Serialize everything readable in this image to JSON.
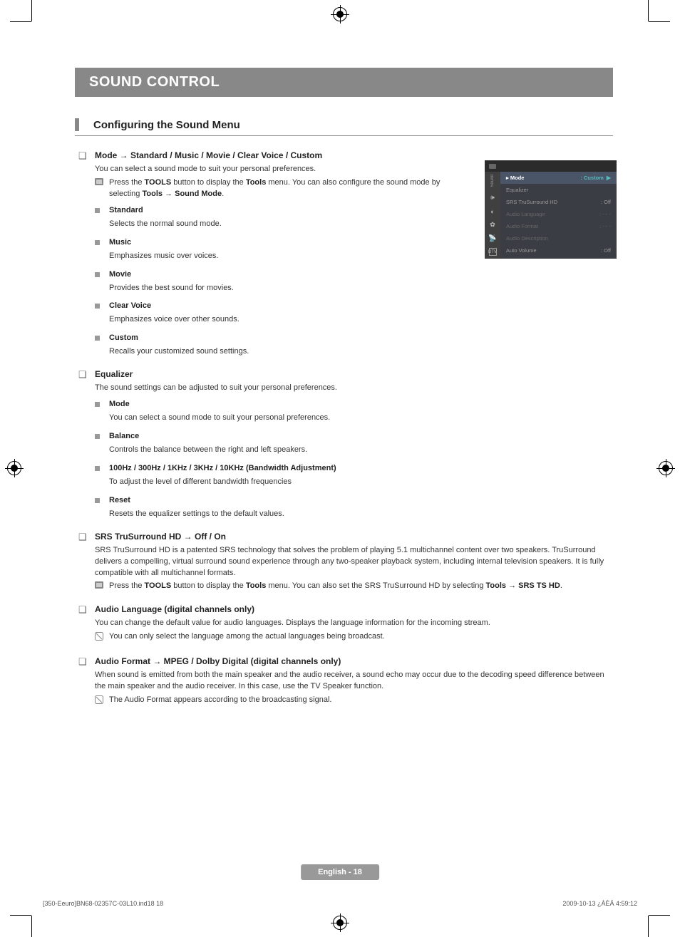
{
  "header": {
    "title": "SOUND CONTROL"
  },
  "section": {
    "title": "Configuring the Sound Menu"
  },
  "mode": {
    "heading": "Mode → Standard / Music / Movie / Clear Voice / Custom",
    "intro": "You can select a sound mode to suit your personal preferences.",
    "tools_note_a": "Press the ",
    "tools_note_b": " button to display the ",
    "tools_note_c": " menu. You can also configure the sound mode by selecting ",
    "tools_note_d": ".",
    "tools_label": "TOOLS",
    "tools_menu": "Tools",
    "tools_path": "Tools → Sound Mode",
    "items": [
      {
        "name": "Standard",
        "desc": "Selects the normal sound mode."
      },
      {
        "name": "Music",
        "desc": "Emphasizes music over voices."
      },
      {
        "name": "Movie",
        "desc": "Provides the best sound for movies."
      },
      {
        "name": "Clear Voice",
        "desc": "Emphasizes voice over other sounds."
      },
      {
        "name": "Custom",
        "desc": "Recalls your customized sound settings."
      }
    ]
  },
  "equalizer": {
    "heading": "Equalizer",
    "intro": "The sound settings can be adjusted to suit your personal preferences.",
    "items": [
      {
        "name": "Mode",
        "desc": "You can select a sound mode to suit your personal preferences."
      },
      {
        "name": "Balance",
        "desc": "Controls the balance between the right and left speakers."
      },
      {
        "name": "100Hz / 300Hz / 1KHz / 3KHz / 10KHz (Bandwidth Adjustment)",
        "desc": "To adjust the level of different bandwidth frequencies"
      },
      {
        "name": "Reset",
        "desc": "Resets the equalizer settings to the default values."
      }
    ]
  },
  "srs": {
    "heading": "SRS TruSurround HD → Off / On",
    "desc": "SRS TruSurround HD is a patented SRS technology that solves the problem of playing 5.1 multichannel content over two speakers. TruSurround delivers a compelling, virtual surround sound experience through any two-speaker playback system, including internal television speakers. It is fully compatible with all multichannel formats.",
    "tools_note_a": "Press the ",
    "tools_note_b": " button to display the ",
    "tools_note_c": " menu. You can also set the SRS TruSurround HD by selecting ",
    "tools_note_d": ".",
    "tools_label": "TOOLS",
    "tools_menu": "Tools",
    "tools_path": "Tools → SRS TS HD"
  },
  "audio_lang": {
    "heading": "Audio Language (digital channels only)",
    "desc": "You can change the default value for audio languages. Displays the language information for the incoming stream.",
    "note": "You can only select the language among the actual languages being broadcast."
  },
  "audio_format": {
    "heading": "Audio Format → MPEG / Dolby Digital (digital channels only)",
    "desc": "When sound is emitted from both the main speaker and the audio receiver, a sound echo may occur due to the decoding speed difference between the main speaker and the audio receiver. In this case, use the TV Speaker function.",
    "note": "The Audio Format appears according to the broadcasting signal."
  },
  "osd": {
    "sidebar_label": "Sound",
    "rows": [
      {
        "label": "Mode",
        "value": ": Custom",
        "highlight": true,
        "chevron": true
      },
      {
        "label": "Equalizer",
        "value": ""
      },
      {
        "label": "SRS TruSurround HD",
        "value": ": Off"
      },
      {
        "label": "Audio Language",
        "value": ": - - -",
        "dim": true
      },
      {
        "label": "Audio Format",
        "value": ": - - -",
        "dim": true
      },
      {
        "label": "Audio Description",
        "value": "",
        "dim": true
      },
      {
        "label": "Auto Volume",
        "value": ": Off"
      }
    ]
  },
  "footer": {
    "page_label": "English - 18"
  },
  "meta": {
    "left": "[350-Eeuro]BN68-02357C-03L10.ind18   18",
    "right": "2009-10-13   ¿ÀÈÄ 4:59:12"
  }
}
